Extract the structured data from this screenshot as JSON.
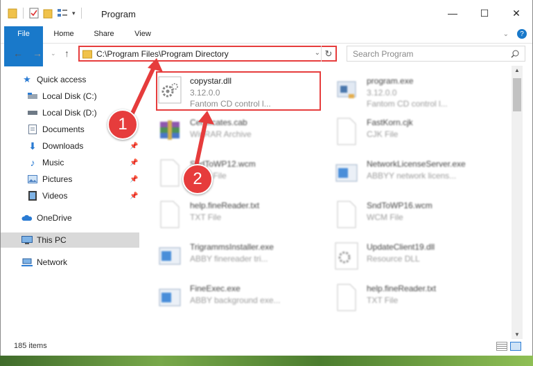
{
  "window": {
    "title": "Program",
    "controls": {
      "minimize": "—",
      "maximize": "☐",
      "close": "✕"
    }
  },
  "ribbon": {
    "tabs": [
      "File",
      "Home",
      "Share",
      "View"
    ],
    "accent": "#1979ca"
  },
  "nav": {
    "address": "C:\\Program Files\\Program Directory",
    "search_placeholder": "Search Program"
  },
  "sidebar": {
    "items": [
      {
        "label": "Quick access",
        "icon": "star-icon"
      },
      {
        "label": "Local Disk (C:)",
        "icon": "drive-icon"
      },
      {
        "label": "Local Disk (D:)",
        "icon": "drive-icon"
      },
      {
        "label": "Documents",
        "icon": "documents-icon"
      },
      {
        "label": "Downloads",
        "icon": "downloads-icon",
        "pinned": true
      },
      {
        "label": "Music",
        "icon": "music-icon",
        "pinned": true
      },
      {
        "label": "Pictures",
        "icon": "pictures-icon",
        "pinned": true
      },
      {
        "label": "Videos",
        "icon": "videos-icon",
        "pinned": true
      },
      {
        "label": "OneDrive",
        "icon": "cloud-icon"
      },
      {
        "label": "This PC",
        "icon": "computer-icon",
        "selected": true
      },
      {
        "label": "Network",
        "icon": "network-icon"
      }
    ]
  },
  "files": [
    {
      "name": "copystar.dll",
      "line2": "3.12.0.0",
      "line3": "Fantom CD control l...",
      "icon": "dll-icon"
    },
    {
      "name": "program.exe",
      "line2": "3.12.0.0",
      "line3": "Fantom CD control l...",
      "icon": "exe-icon"
    },
    {
      "name": "Certificates.cab",
      "line2": "WinRAR Archive",
      "line3": "",
      "icon": "archive-icon"
    },
    {
      "name": "FastKorn.cjk",
      "line2": "CJK File",
      "line3": "",
      "icon": "file-icon"
    },
    {
      "name": "SndToWP12.wcm",
      "line2": "WCM File",
      "line3": "",
      "icon": "file-icon"
    },
    {
      "name": "NetworkLicenseServer.exe",
      "line2": "ABBYY network licens...",
      "line3": "",
      "icon": "app-icon"
    },
    {
      "name": "help.fineReader.txt",
      "line2": "TXT File",
      "line3": "",
      "icon": "file-icon"
    },
    {
      "name": "SndToWP16.wcm",
      "line2": "WCM File",
      "line3": "",
      "icon": "file-icon"
    },
    {
      "name": "TrigrammsInstaller.exe",
      "line2": "ABBY finereader tri...",
      "line3": "",
      "icon": "app-icon"
    },
    {
      "name": "UpdateClient19.dll",
      "line2": "Resource DLL",
      "line3": "",
      "icon": "dll-icon"
    },
    {
      "name": "FineExec.exe",
      "line2": "ABBY background exe...",
      "line3": "",
      "icon": "app-icon"
    },
    {
      "name": "help.fineReader.txt",
      "line2": "TXT File",
      "line3": "",
      "icon": "file-icon"
    }
  ],
  "status": {
    "count": "185 items"
  },
  "callouts": [
    "1",
    "2"
  ],
  "highlight_color": "#e63c3c"
}
